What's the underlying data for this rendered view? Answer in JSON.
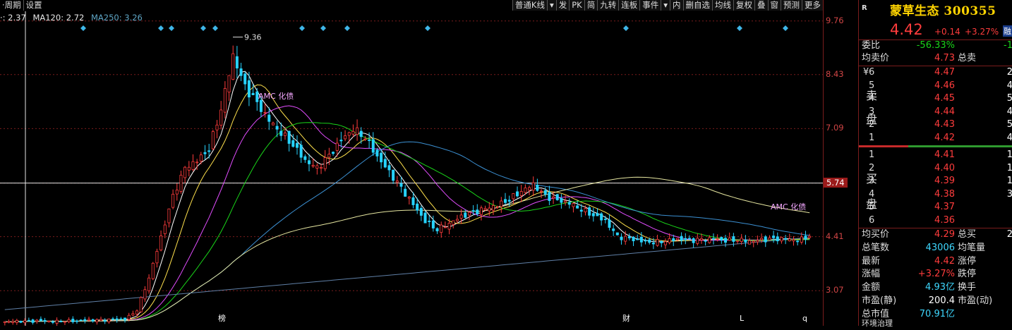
{
  "toolbar": {
    "left_items": [
      "·周期",
      "设置"
    ],
    "right_items": [
      "普通K线",
      "▾",
      "发",
      "PK",
      "简",
      "九转",
      "连板",
      "事件",
      "▾",
      "内",
      "删自选",
      "均线",
      "复权",
      "叠",
      "窗",
      "预测",
      "更多"
    ]
  },
  "ma": [
    {
      "label": "·: 2.37",
      "color": "#e8e8e8"
    },
    {
      "label": "MA120: 2.72",
      "color": "#e8e8e8"
    },
    {
      "label": "MA250: 3.26",
      "color": "#5fa6c6"
    }
  ],
  "annotations": {
    "high": "9.36",
    "amc1": "AMC 化债",
    "amc2": "AMC 化债",
    "b1": "榜",
    "b2": "财",
    "b3": "L",
    "b4": "q"
  },
  "y_axis": {
    "labels": [
      "9.76",
      "8.43",
      "7.09",
      "5.74",
      "4.41",
      "3.07"
    ],
    "highlight": "5.74"
  },
  "chart_data": {
    "type": "candlestick",
    "y_ticks": [
      9.76,
      8.43,
      7.09,
      5.74,
      4.41,
      3.07
    ],
    "crosshair_price": 5.74,
    "period_high": 9.36,
    "ylim": [
      2.2,
      10.0
    ],
    "close_series": [
      2.3,
      2.31,
      2.3,
      2.32,
      2.31,
      2.33,
      2.32,
      2.34,
      2.33,
      2.35,
      2.36,
      2.6,
      3.4,
      4.4,
      5.4,
      6.1,
      6.3,
      6.6,
      7.6,
      8.9,
      8.1,
      7.7,
      7.3,
      7.0,
      6.7,
      6.3,
      6.1,
      6.4,
      6.8,
      7.1,
      6.9,
      6.4,
      6.0,
      5.6,
      5.2,
      4.8,
      4.6,
      4.75,
      4.9,
      5.0,
      5.1,
      5.2,
      5.35,
      5.55,
      5.7,
      5.4,
      5.3,
      5.25,
      5.1,
      4.95,
      4.8,
      4.4,
      4.35,
      4.3,
      4.28,
      4.32,
      4.35,
      4.3,
      4.33,
      4.36,
      4.32,
      4.35,
      4.3,
      4.32,
      4.34,
      4.36,
      4.33,
      4.42
    ]
  },
  "side": {
    "r_flag": "R",
    "name": "蒙草生态",
    "code": "300355",
    "price": "4.42",
    "chg": "+0.14",
    "chg_pct": "+3.27%",
    "tag": "融",
    "weibi_label": "委比",
    "weibi": "-56.33%",
    "weibi_right": "-1",
    "avg_sell_label": "均卖价",
    "avg_sell": "4.73",
    "total_sell_label": "总卖",
    "sell_side_label": "卖盘",
    "buy_side_label": "买盘",
    "yen": "¥",
    "asks": [
      {
        "lvl": "6",
        "price": "4.47",
        "vol": "2"
      },
      {
        "lvl": "5",
        "price": "4.46",
        "vol": "4"
      },
      {
        "lvl": "4",
        "price": "4.45",
        "vol": "5"
      },
      {
        "lvl": "3",
        "price": "4.44",
        "vol": "4"
      },
      {
        "lvl": "2",
        "price": "4.43",
        "vol": "5"
      },
      {
        "lvl": "1",
        "price": "4.42",
        "vol": "4"
      }
    ],
    "bids": [
      {
        "lvl": "1",
        "price": "4.41",
        "vol": "1"
      },
      {
        "lvl": "2",
        "price": "4.40",
        "vol": "1"
      },
      {
        "lvl": "3",
        "price": "4.39",
        "vol": "1"
      },
      {
        "lvl": "4",
        "price": "4.38",
        "vol": "3"
      },
      {
        "lvl": "5",
        "price": "4.37",
        "vol": ""
      },
      {
        "lvl": "6",
        "price": "4.36",
        "vol": ""
      }
    ],
    "avg_buy_label": "均买价",
    "avg_buy": "4.29",
    "total_buy_label": "总买",
    "total_buy_right": "2",
    "stats": [
      {
        "l": "总笔数",
        "v": "43006",
        "r": "均笔量",
        "vc": "cyan"
      },
      {
        "l": "最新",
        "v": "4.42",
        "r": "涨停",
        "vc": "red"
      },
      {
        "l": "涨幅",
        "v": "+3.27%",
        "r": "跌停",
        "vc": "red"
      },
      {
        "l": "金额",
        "v": "4.93亿",
        "r": "换手",
        "vc": "cyan"
      },
      {
        "l": "市盈(静)",
        "v": "200.4",
        "r": "市盈(动)",
        "vc": "white"
      },
      {
        "l": "总市值",
        "v": "70.91亿",
        "r": "",
        "vc": "cyan"
      }
    ],
    "footer": "环境治理"
  },
  "colors": {
    "up": "#ff3c3c",
    "down": "#27d3ff",
    "grid": "#7a1c1c",
    "ma5": "#ffffff",
    "ma10": "#ffe14d",
    "ma20": "#e24dff",
    "ma30": "#19d419",
    "ma60": "#3b8fd1",
    "ma120": "#e6e6a0",
    "ma250": "#5f7fa6"
  }
}
